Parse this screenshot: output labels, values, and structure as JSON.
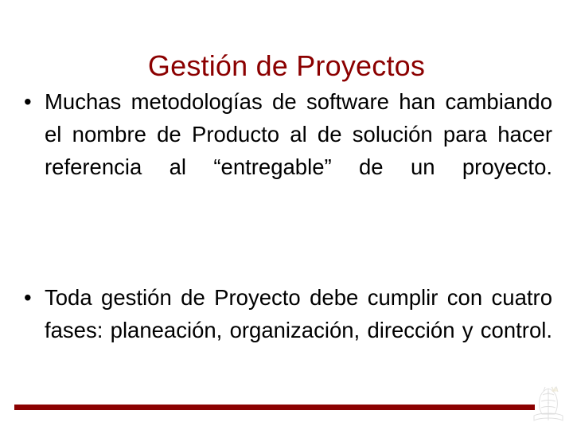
{
  "slide": {
    "title": "Gestión de Proyectos",
    "title_color": "#8B0000",
    "background_color": "#FFFFFF",
    "body_text_color": "#000000",
    "bullets": [
      {
        "marker": "•",
        "text": "Muchas metodologías de software han cambiando el nombre de Producto al de solución para hacer referencia al “entregable” de un proyecto."
      },
      {
        "marker": "•",
        "text": "Toda gestión de Proyecto debe cumplir con cuatro fases: planeación, organización, dirección y control."
      }
    ],
    "footer": {
      "rule_color": "#8B0000",
      "emblem_name": "institutional-crest-watermark"
    }
  }
}
